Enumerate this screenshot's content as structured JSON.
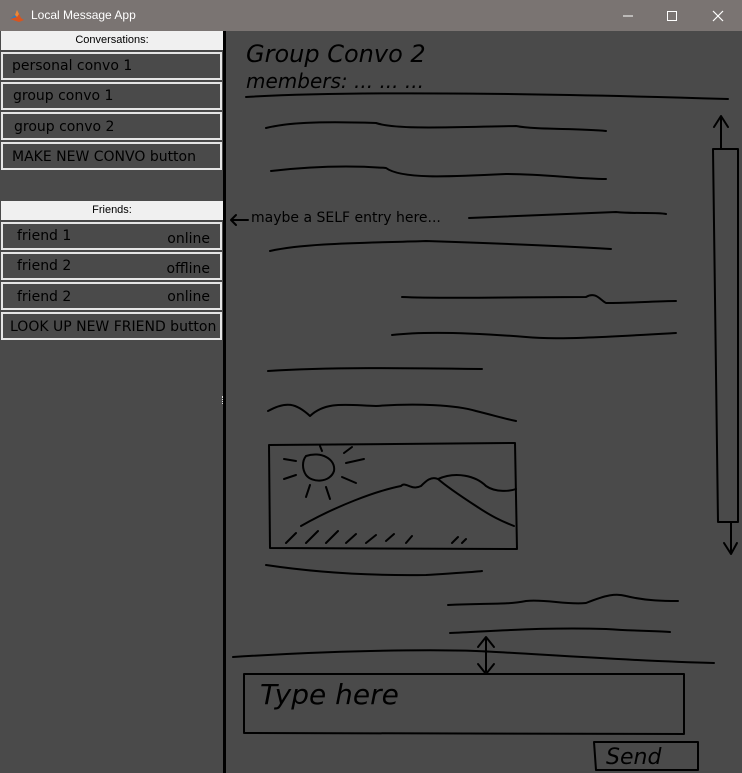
{
  "window": {
    "title": "Local Message App",
    "controls": [
      "minimize-icon",
      "maximize-icon",
      "close-icon"
    ]
  },
  "conversations": {
    "header": "Conversations:",
    "items": [
      {
        "label": "personal convo 1"
      },
      {
        "label": "group convo 1"
      },
      {
        "label": "group convo 2"
      }
    ],
    "new_button": "MAKE NEW CONVO button"
  },
  "friends": {
    "header": "Friends:",
    "items": [
      {
        "name": "friend 1",
        "status": "online"
      },
      {
        "name": "friend 2",
        "status": "offline"
      },
      {
        "name": "friend 2",
        "status": "online"
      }
    ],
    "lookup_button": "LOOK UP NEW FRIEND button"
  },
  "sketch": {
    "convo_title": "Group Convo 2",
    "members_label": "members: ... ... ...",
    "self_note": "maybe a SELF entry here...",
    "input_placeholder": "Type here",
    "send_label": "Send"
  },
  "colors": {
    "titlebar": "#7a7472",
    "panel_bg": "#4a4a4a",
    "header_bg": "#f0f0f0",
    "button_border": "#e6e6e6",
    "sketch_ink": "#000000"
  }
}
